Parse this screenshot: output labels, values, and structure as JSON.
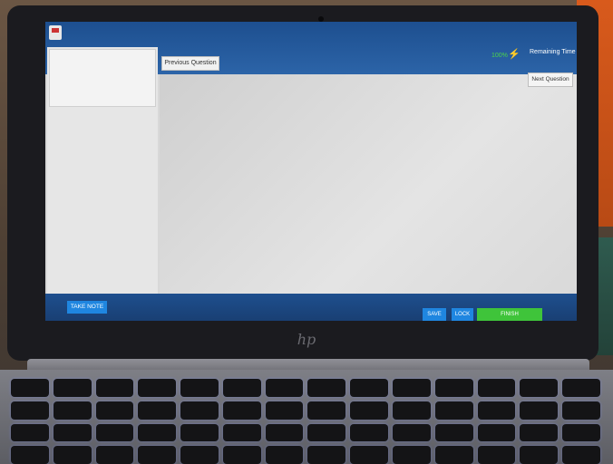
{
  "header": {
    "battery": "100%",
    "remaining_time_label": "Remaining Time"
  },
  "navigation": {
    "previous_label": "Previous Question",
    "next_label": "Next Question"
  },
  "footer": {
    "take_note_label": "TAKE NOTE",
    "save_label": "SAVE",
    "lock_label": "LOCK",
    "finish_label": "FINISH"
  },
  "icons": {
    "app_logo": "app-logo-icon",
    "battery": "battery-charging-icon"
  },
  "colors": {
    "header_bar": "#2c64a8",
    "primary_button": "#1f86e0",
    "finish_button": "#3fc43a",
    "battery_text": "#4cd34c"
  }
}
